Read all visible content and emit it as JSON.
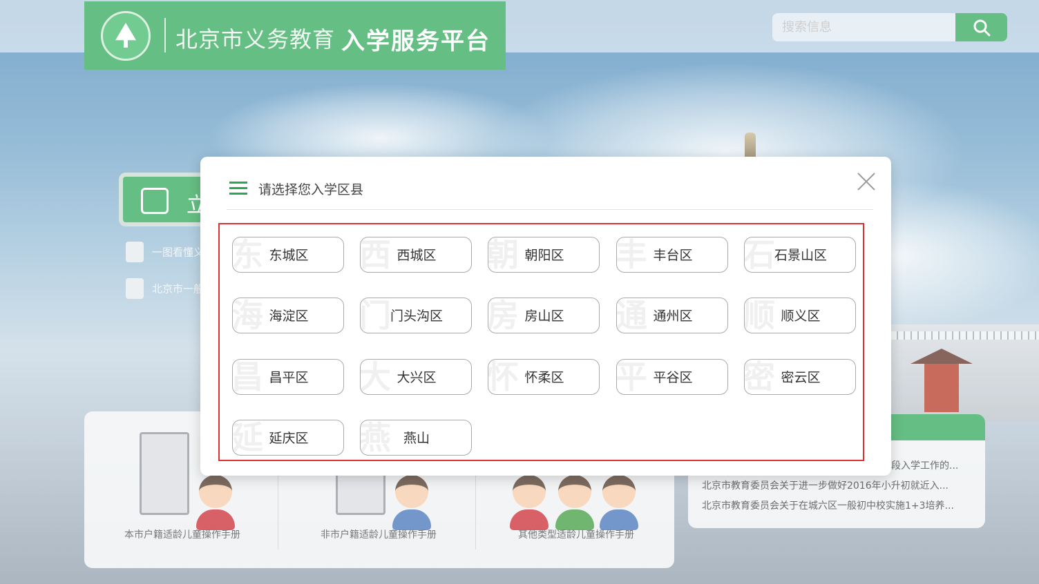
{
  "header": {
    "logo_text_plain": "北京市义务教育",
    "logo_text_bold": "入学服务平台",
    "search": {
      "placeholder": "搜索信息"
    }
  },
  "sidebar": {
    "enroll_button_label": "立",
    "links": [
      {
        "label": "一图看懂义"
      },
      {
        "label": "北京市一般"
      }
    ]
  },
  "manuals": [
    {
      "label": "本市户籍适龄儿童操作手册"
    },
    {
      "label": "非市户籍适龄儿童操作手册"
    },
    {
      "label": "其他类型适龄儿童操作手册"
    }
  ],
  "news": [
    {
      "title": "段入学工作的..."
    },
    {
      "title": "北京市教育委员会关于进一步做好2016年小升初就近入..."
    },
    {
      "title": "北京市教育委员会关于在城六区一般初中校实施1+3培养..."
    }
  ],
  "modal": {
    "title": "请选择您入学区县",
    "districts": [
      {
        "name": "东城区",
        "watermark": "东"
      },
      {
        "name": "西城区",
        "watermark": "西"
      },
      {
        "name": "朝阳区",
        "watermark": "朝"
      },
      {
        "name": "丰台区",
        "watermark": "丰"
      },
      {
        "name": "石景山区",
        "watermark": "石"
      },
      {
        "name": "海淀区",
        "watermark": "海"
      },
      {
        "name": "门头沟区",
        "watermark": "门"
      },
      {
        "name": "房山区",
        "watermark": "房"
      },
      {
        "name": "通州区",
        "watermark": "通"
      },
      {
        "name": "顺义区",
        "watermark": "顺"
      },
      {
        "name": "昌平区",
        "watermark": "昌"
      },
      {
        "name": "大兴区",
        "watermark": "大"
      },
      {
        "name": "怀柔区",
        "watermark": "怀"
      },
      {
        "name": "平谷区",
        "watermark": "平"
      },
      {
        "name": "密云区",
        "watermark": "密"
      },
      {
        "name": "延庆区",
        "watermark": "延"
      },
      {
        "name": "燕山",
        "watermark": "燕"
      }
    ]
  },
  "colors": {
    "brand_green": "#2aa654",
    "highlight_border": "#e03131"
  }
}
